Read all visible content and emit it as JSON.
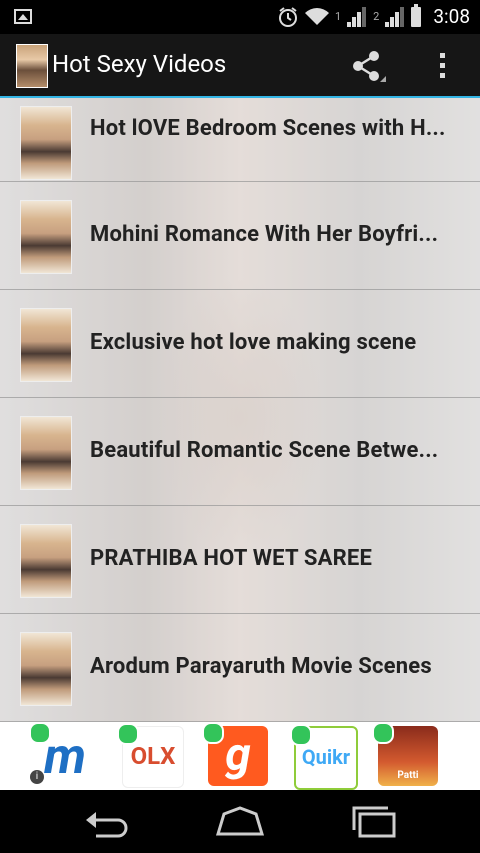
{
  "status_bar": {
    "sim1": "1",
    "sim2": "2",
    "time": "3:08"
  },
  "action_bar": {
    "title": "Hot Sexy Videos",
    "share_icon": "share-icon",
    "overflow_icon": "overflow-menu-icon"
  },
  "list": {
    "items": [
      {
        "title": "Hot lOVE Bedroom Scenes with H..."
      },
      {
        "title": "Mohini Romance With Her Boyfri..."
      },
      {
        "title": "Exclusive hot love making scene"
      },
      {
        "title": "Beautiful Romantic Scene Betwe..."
      },
      {
        "title": "PRATHIBA HOT WET SAREE"
      },
      {
        "title": "Arodum Parayaruth Movie Scenes"
      }
    ]
  },
  "ads": {
    "items": [
      {
        "name": "m",
        "color": "#1e6fc4"
      },
      {
        "name": "OLX",
        "color": "#d84d2f"
      },
      {
        "name": "g",
        "color": "#ff5a1f"
      },
      {
        "name": "Quikr",
        "color": "#3fa9f5"
      },
      {
        "name": "Patti",
        "color": "#c43d24"
      }
    ],
    "info_label": "i"
  },
  "nav_bar": {
    "back": "back-icon",
    "home": "home-icon",
    "recents": "recents-icon"
  }
}
